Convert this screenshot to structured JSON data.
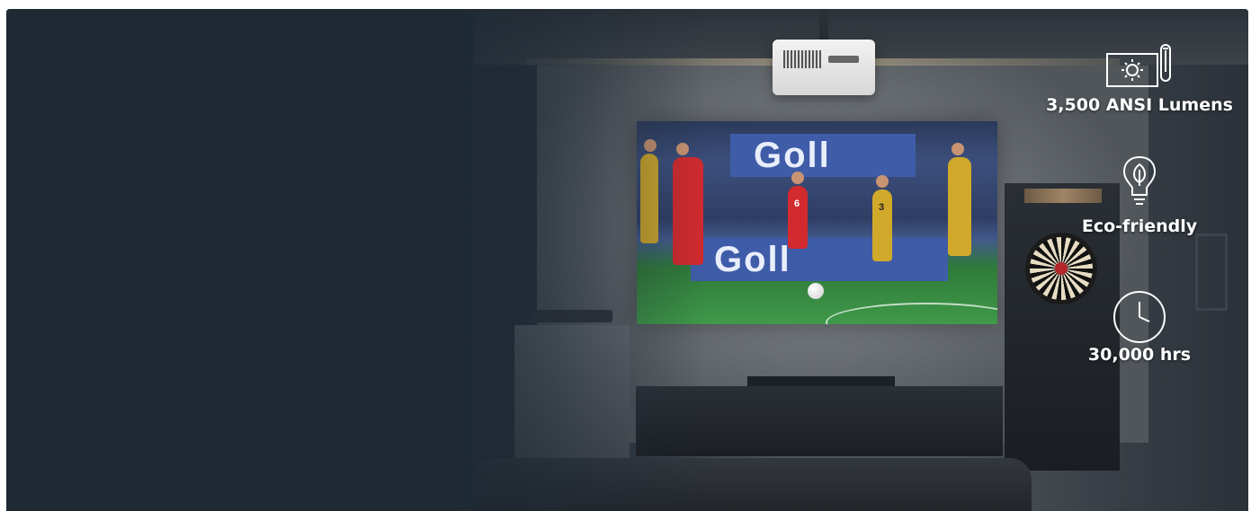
{
  "features": [
    {
      "icon": "lumens-icon",
      "label": "3,500 ANSI Lumens"
    },
    {
      "icon": "eco-leaf-bulb-icon",
      "label": "Eco-friendly"
    },
    {
      "icon": "clock-icon",
      "label": "30,000 hrs"
    }
  ],
  "screen": {
    "banner_top": "Goll",
    "banner_bottom": "Goll",
    "jersey_number_red": "6",
    "jersey_number_yellow": "3"
  },
  "colors": {
    "background": "#1f2a36",
    "label_text": "#ffffff",
    "banner_blue": "#3f5ca8"
  }
}
